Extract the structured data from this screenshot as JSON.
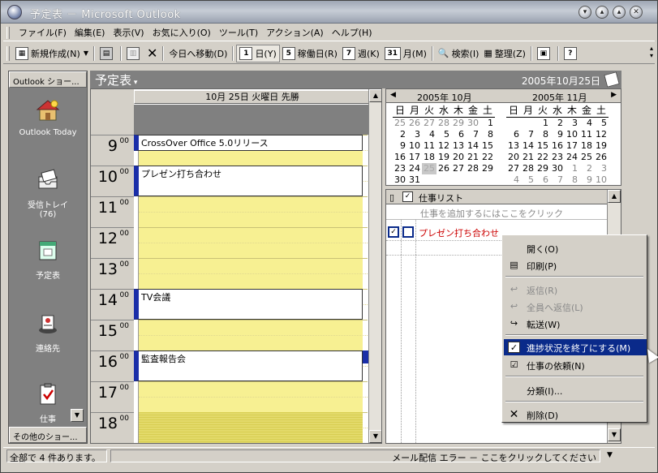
{
  "window": {
    "title": "予定表 － Microsoft Outlook"
  },
  "menu": [
    "ファイル(F)",
    "編集(E)",
    "表示(V)",
    "お気に入り(O)",
    "ツール(T)",
    "アクション(A)",
    "ヘルプ(H)"
  ],
  "toolbar": {
    "new": "新規作成(N)",
    "goto_today": "今日へ移動(D)",
    "day": "日(Y)",
    "workweek": "稼働日(R)",
    "week": "週(K)",
    "month": "月(M)",
    "find": "検索(I)",
    "organize": "整理(Z)",
    "day_num": "1",
    "workweek_num": "5",
    "week_num": "7",
    "month_num": "31"
  },
  "shortcuts": {
    "header": "Outlook ショー...",
    "footer": "その他のショー...",
    "items": [
      {
        "label": "Outlook Today"
      },
      {
        "label": "受信トレイ",
        "count": "(76)"
      },
      {
        "label": "予定表"
      },
      {
        "label": "連絡先"
      },
      {
        "label": "仕事"
      }
    ]
  },
  "calendar": {
    "title": "予定表",
    "date": "2005年10月25日",
    "day_header": "10月 25日 火曜日  先勝",
    "hours": [
      "9",
      "10",
      "11",
      "12",
      "13",
      "14",
      "15",
      "16",
      "17",
      "18"
    ],
    "minutes": "00",
    "appointments": [
      {
        "title": "CrossOver Office 5.0リリース"
      },
      {
        "title": "プレゼン打ち合わせ"
      },
      {
        "title": "TV会議"
      },
      {
        "title": "監査報告会"
      }
    ]
  },
  "minical": {
    "oct_label": "2005年 10月",
    "nov_label": "2005年 11月",
    "dow": [
      "日",
      "月",
      "火",
      "水",
      "木",
      "金",
      "土"
    ],
    "oct": [
      [
        "25",
        "26",
        "27",
        "28",
        "29",
        "30",
        "1"
      ],
      [
        "2",
        "3",
        "4",
        "5",
        "6",
        "7",
        "8"
      ],
      [
        "9",
        "10",
        "11",
        "12",
        "13",
        "14",
        "15"
      ],
      [
        "16",
        "17",
        "18",
        "19",
        "20",
        "21",
        "22"
      ],
      [
        "23",
        "24",
        "25",
        "26",
        "27",
        "28",
        "29"
      ],
      [
        "30",
        "31",
        "",
        "",
        "",
        "",
        ""
      ]
    ],
    "nov": [
      [
        "",
        "",
        "1",
        "2",
        "3",
        "4",
        "5"
      ],
      [
        "6",
        "7",
        "8",
        "9",
        "10",
        "11",
        "12"
      ],
      [
        "13",
        "14",
        "15",
        "16",
        "17",
        "18",
        "19"
      ],
      [
        "20",
        "21",
        "22",
        "23",
        "24",
        "25",
        "26"
      ],
      [
        "27",
        "28",
        "29",
        "30",
        "1",
        "2",
        "3"
      ],
      [
        "4",
        "5",
        "6",
        "7",
        "8",
        "9",
        "10"
      ]
    ]
  },
  "tasks": {
    "header": "仕事リスト",
    "add_placeholder": "仕事を追加するにはここをクリック",
    "items": [
      {
        "title": "プレゼン打ち合わせ"
      }
    ]
  },
  "context_menu": [
    {
      "label": "開く(O)"
    },
    {
      "label": "印刷(P)"
    },
    {
      "label": "返信(R)"
    },
    {
      "label": "全員へ返信(L)"
    },
    {
      "label": "転送(W)"
    },
    {
      "label": "進捗状況を終了にする(M)"
    },
    {
      "label": "仕事の依頼(N)"
    },
    {
      "label": "分類(I)..."
    },
    {
      "label": "削除(D)"
    }
  ],
  "status": {
    "count": "全部で 4 件あります。",
    "message": "メール配信 エラー － ここをクリックしてください"
  }
}
